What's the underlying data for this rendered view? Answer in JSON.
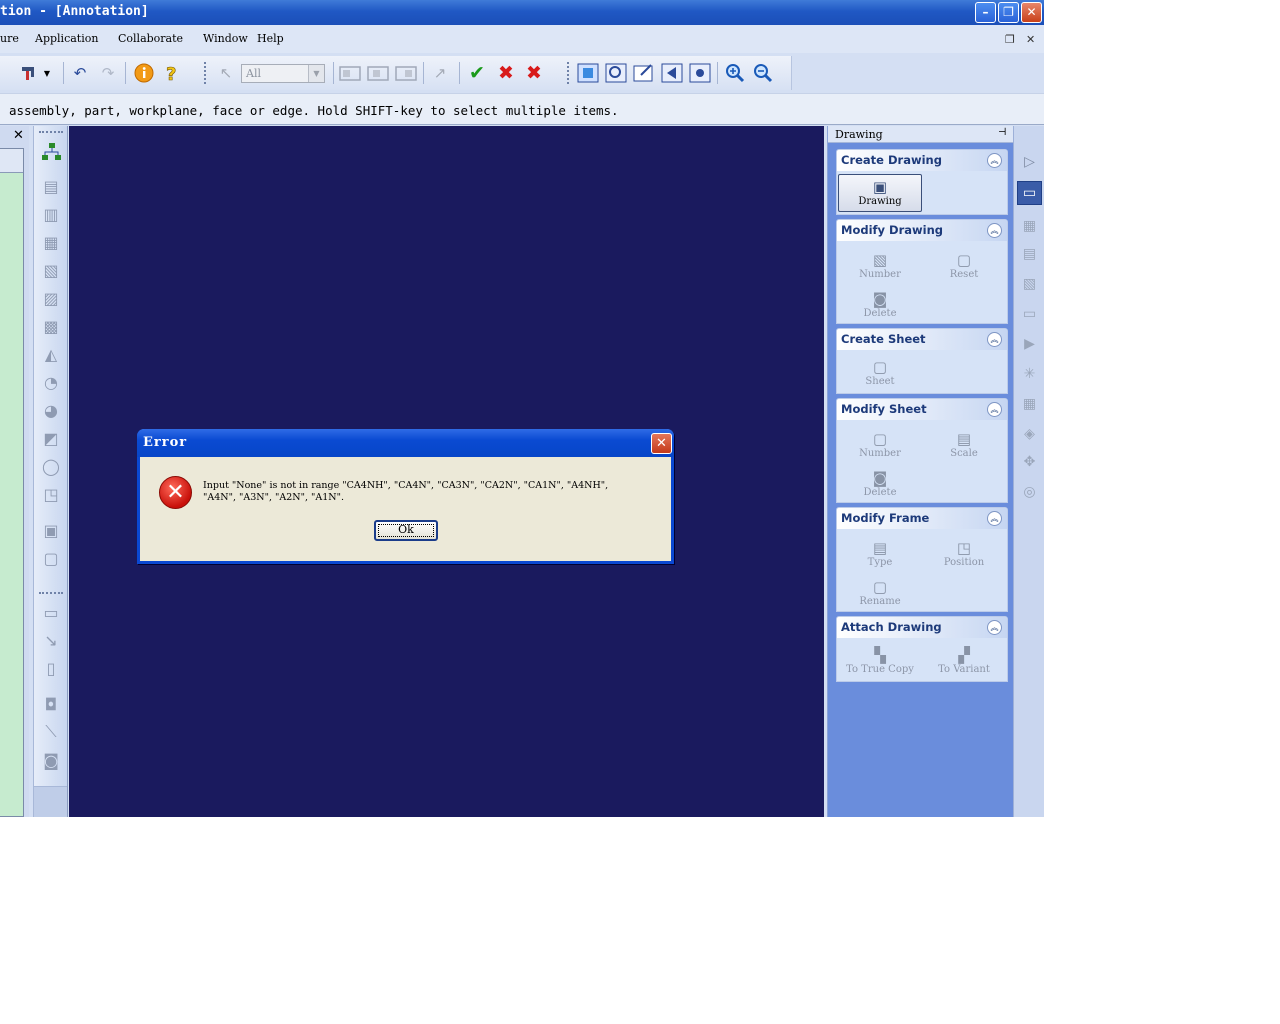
{
  "window": {
    "title": "tion - [Annotation]",
    "minimize": "–",
    "restore": "❐",
    "close": "✕"
  },
  "menubar": {
    "items": [
      "ure",
      "Application",
      "Collaborate",
      "Window",
      "Help"
    ],
    "mdi_restore": "❐",
    "mdi_close": "✕"
  },
  "toolbar": {
    "filter_value": "All"
  },
  "prompt": {
    "text": "assembly, part, workplane, face or edge. Hold SHIFT-key to select multiple items."
  },
  "left_panel": {
    "close": "✕"
  },
  "right_panel": {
    "title": "Drawing",
    "pin": "⊣",
    "groups": [
      {
        "title": "Create Drawing",
        "buttons": [
          "Drawing"
        ]
      },
      {
        "title": "Modify Drawing",
        "buttons": [
          "Number",
          "Reset",
          "Delete"
        ]
      },
      {
        "title": "Create Sheet",
        "buttons": [
          "Sheet"
        ]
      },
      {
        "title": "Modify Sheet",
        "buttons": [
          "Number",
          "Scale",
          "Delete"
        ]
      },
      {
        "title": "Modify Frame",
        "buttons": [
          "Type",
          "Position",
          "Rename"
        ]
      },
      {
        "title": "Attach Drawing",
        "buttons": [
          "To True Copy",
          "To Variant"
        ]
      }
    ]
  },
  "dialog": {
    "title": "Error",
    "close": "✕",
    "icon": "✕",
    "message": "Input \"None\" is not in range  \"CA4NH\", \"CA4N\", \"CA3N\", \"CA2N\", \"CA1N\", \"A4NH\", \"A4N\", \"A3N\", \"A2N\", \"A1N\".",
    "ok_label": "Ok"
  }
}
